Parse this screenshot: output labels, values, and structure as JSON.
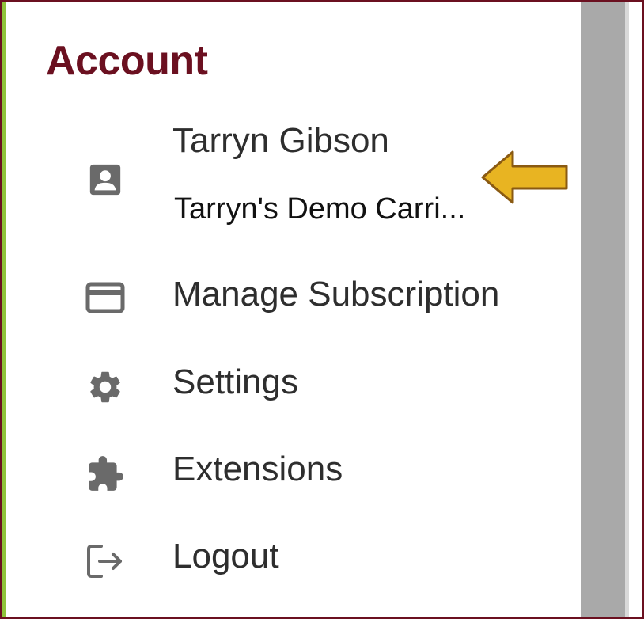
{
  "menu": {
    "heading": "Account",
    "profile": {
      "name": "Tarryn Gibson",
      "company": "Tarryn's Demo Carri...",
      "icon": "account-box-icon"
    },
    "items": [
      {
        "label": "Manage Subscription",
        "icon": "credit-card-icon"
      },
      {
        "label": "Settings",
        "icon": "gear-icon"
      },
      {
        "label": "Extensions",
        "icon": "puzzle-icon"
      },
      {
        "label": "Logout",
        "icon": "logout-icon"
      }
    ]
  },
  "colors": {
    "heading": "#6b1020",
    "border": "#6b1020",
    "accent_left": "#8fc43a",
    "arrow_fill": "#e8b422",
    "arrow_stroke": "#8a5a12",
    "icon": "#6a6a6a",
    "gutter": "#a9a9a9"
  }
}
